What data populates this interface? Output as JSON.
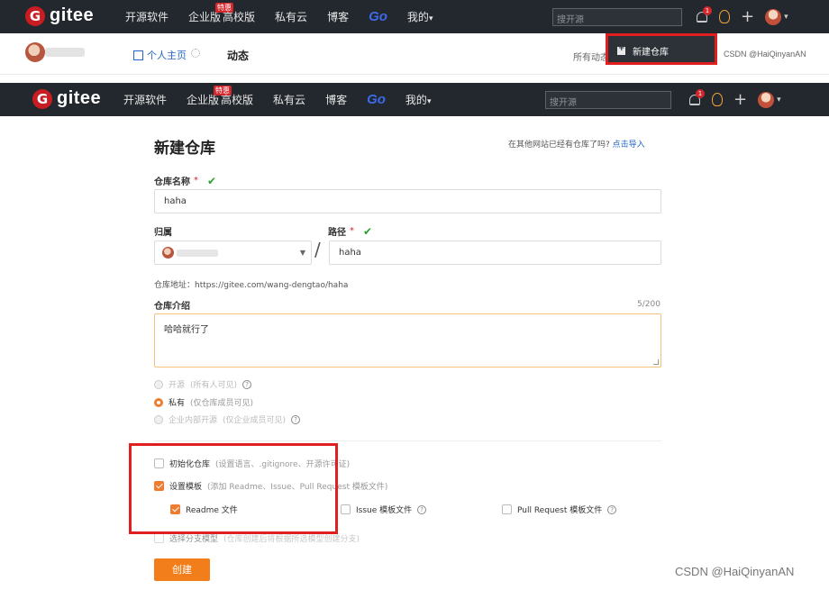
{
  "brand": {
    "logo_letter": "G",
    "name": "gitee"
  },
  "nav": {
    "links": [
      "开源软件",
      "企业版",
      "高校版",
      "私有云",
      "博客",
      "Go",
      "我的"
    ],
    "hot_tag": "特惠",
    "my_caret": "▾",
    "search_placeholder": "搜开源",
    "notification_count": "1"
  },
  "subnav": {
    "home": "个人主页",
    "feed": "动态",
    "all_feed": "所有动态"
  },
  "dropdown": {
    "new_repo": "新建仓库"
  },
  "watermark": "CSDN @HaiQinyanAN",
  "form": {
    "title": "新建仓库",
    "import_prefix": "在其他网站已经有仓库了吗?",
    "import_link": "点击导入",
    "repo_name_label": "仓库名称",
    "repo_name_value": "haha",
    "owner_label": "归属",
    "path_label": "路径",
    "path_value": "haha",
    "required_mark": "*",
    "check_mark": "✔",
    "slash": "/",
    "repo_address": "仓库地址：https://gitee.com/wang-dengtao/haha",
    "desc_label": "仓库介绍",
    "desc_counter": "5/200",
    "desc_value": "哈哈就行了",
    "visibility": [
      {
        "label": "开源",
        "hint": "(所有人可见)",
        "selected": false,
        "disabled": true,
        "help": "?"
      },
      {
        "label": "私有",
        "hint": "(仅仓库成员可见)",
        "selected": true,
        "disabled": false,
        "help": ""
      },
      {
        "label": "企业内部开源",
        "hint": "(仅企业成员可见)",
        "selected": false,
        "disabled": true,
        "help": "?"
      }
    ],
    "init_repo": {
      "label": "初始化仓库",
      "hint": "(设置语言、.gitignore、开源许可证)",
      "checked": false
    },
    "template": {
      "label": "设置模板",
      "hint": "(添加 Readme、Issue、Pull Request 模板文件)",
      "checked": true
    },
    "template_files": [
      {
        "label": "Readme 文件",
        "checked": true
      },
      {
        "label": "Issue 模板文件",
        "checked": false
      },
      {
        "label": "Pull Request 模板文件",
        "checked": false
      }
    ],
    "branch_model": {
      "label": "选择分支模型",
      "hint": "(仓库创建后将根据所选模型创建分支)",
      "checked": false
    },
    "create_button": "创建"
  },
  "colors": {
    "accent": "#f27d1b",
    "navbar": "#23282e",
    "highlight": "#e02020",
    "link": "#2366c6"
  }
}
